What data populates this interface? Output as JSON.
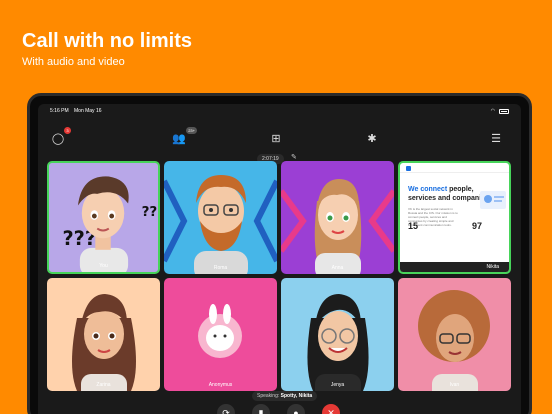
{
  "hero": {
    "title": "Call with no limits",
    "subtitle": "With audio and video"
  },
  "statusbar": {
    "time": "5:16 PM",
    "date": "Mon May 16"
  },
  "toolbar": {
    "chat_badge": "3",
    "participants_count": "23+"
  },
  "call": {
    "timer": "2:07:19"
  },
  "participants": [
    {
      "name": "You",
      "bg": "#b8a7e8"
    },
    {
      "name": "Roma",
      "bg": "#46b6e8"
    },
    {
      "name": "Anna",
      "bg": "#9b3fd4"
    },
    {
      "name": "Nikita",
      "bg": "#ffffff"
    },
    {
      "name": "Zarina",
      "bg": "#ffd2ac"
    },
    {
      "name": "Anonymus",
      "bg": "#ee4c9b"
    },
    {
      "name": "Jenya",
      "bg": "#8cd0ee"
    },
    {
      "name": "Ivan",
      "bg": "#f08ea8"
    }
  ],
  "screen_share": {
    "title_blue": "We connect",
    "title_rest": " people, services and companies",
    "text": "VK is the largest social network in Russia and the CIS. Our mission is to connect people, services and companies by creating simple and convenient communication tools.",
    "stat1": "15",
    "stat2": "97"
  },
  "speaking": {
    "label": "Speaking:",
    "names": "Spotty, Nikita"
  },
  "colors": {
    "accent": "#ff8a00",
    "active_border": "#47d45a",
    "end_call": "#e53935"
  }
}
